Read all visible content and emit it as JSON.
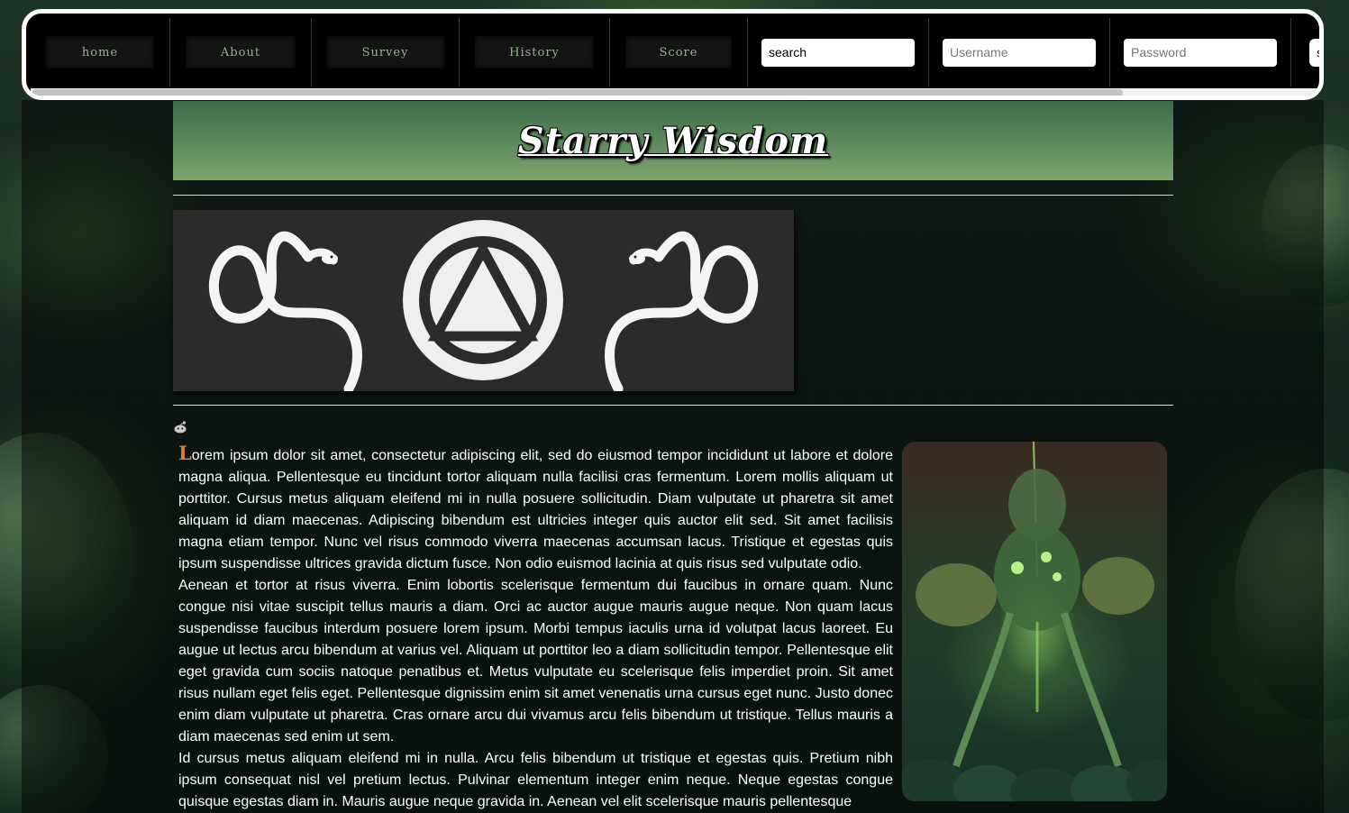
{
  "nav": {
    "items": [
      {
        "label": "home"
      },
      {
        "label": "About"
      },
      {
        "label": "Survey"
      },
      {
        "label": "History"
      },
      {
        "label": "Score"
      }
    ],
    "search": {
      "value": "search"
    },
    "username": {
      "placeholder": "Username"
    },
    "password": {
      "placeholder": "Password"
    },
    "submit_label": "submit"
  },
  "header": {
    "title": "Starry Wisdom"
  },
  "article": {
    "dropcap": "L",
    "paragraphs": [
      "orem ipsum dolor sit amet, consectetur adipiscing elit, sed do eiusmod tempor incididunt ut labore et dolore magna aliqua. Pellentesque eu tincidunt tortor aliquam nulla facilisi cras fermentum. Lorem mollis aliquam ut porttitor. Cursus metus aliquam eleifend mi in nulla posuere sollicitudin. Diam vulputate ut pharetra sit amet aliquam id diam maecenas. Adipiscing bibendum est ultricies integer quis auctor elit sed. Sit amet facilisis magna etiam tempor. Nunc vel risus commodo viverra maecenas accumsan lacus. Tristique et egestas quis ipsum suspendisse ultrices gravida dictum fusce. Non odio euismod lacinia at quis risus sed vulputate odio.",
      "Aenean et tortor at risus viverra. Enim lobortis scelerisque fermentum dui faucibus in ornare quam. Nunc congue nisi vitae suscipit tellus mauris a diam. Orci ac auctor augue mauris augue neque. Non quam lacus suspendisse faucibus interdum posuere lorem ipsum. Morbi tempus iaculis urna id volutpat lacus laoreet. Eu augue ut lectus arcu bibendum at varius vel. Aliquam ut porttitor leo a diam sollicitudin tempor. Pellentesque elit eget gravida cum sociis natoque penatibus et. Metus vulputate eu scelerisque felis imperdiet proin. Sit amet risus nullam eget felis eget. Pellentesque dignissim enim sit amet venenatis urna cursus eget nunc. Justo donec enim diam vulputate ut pharetra. Cras ornare arcu dui vivamus arcu felis bibendum ut tristique. Tellus mauris a diam maecenas sed enim ut sem.",
      "Id cursus metus aliquam eleifend mi in nulla. Arcu felis bibendum ut tristique et egestas quis. Pretium nibh ipsum consequat nisl vel pretium lectus. Pulvinar elementum integer enim neque. Neque egestas congue quisque egestas diam in. Mauris augue neque gravida in. Aenean vel elit scelerisque mauris pellentesque"
    ]
  },
  "colors": {
    "accent": "#d9822b",
    "nav_text": "#8fb78a",
    "banner_top": "#3e6a4a",
    "banner_bottom": "#7fa56c"
  }
}
